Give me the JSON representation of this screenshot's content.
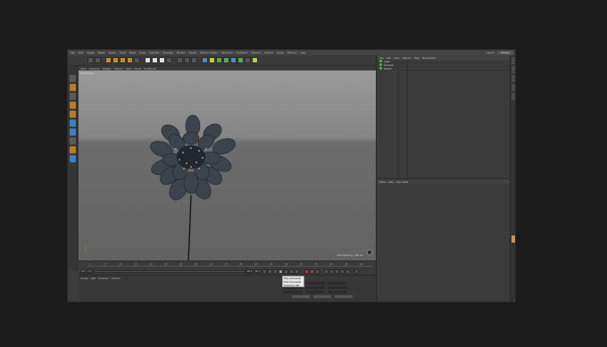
{
  "menubar": {
    "items": [
      "File",
      "Edit",
      "Create",
      "Mode",
      "Select",
      "Tools",
      "Mesh",
      "Snap",
      "Animate",
      "Simulate",
      "Render",
      "Sculpt",
      "Motion Tracker",
      "MoGraph",
      "Character",
      "Pipeline",
      "Plugins",
      "Script",
      "Window",
      "Help"
    ],
    "layout_label": "Layout:",
    "layout_value": "Startup"
  },
  "viewport": {
    "menu": [
      "View",
      "Cameras",
      "Display",
      "Options",
      "Filter",
      "Panel",
      "ProRender"
    ],
    "label": "Perspective",
    "grid_info": "Grid Spacing : 100 cm"
  },
  "timeline": {
    "ticks": [
      "0",
      "5",
      "10",
      "15",
      "20",
      "25",
      "30",
      "35",
      "40",
      "45",
      "50",
      "55",
      "60",
      "65",
      "70",
      "75",
      "80",
      "85",
      "90"
    ],
    "start": "0 F",
    "field_a": "0 F",
    "end_a": "90 F",
    "end_b": "90 F",
    "tooltip_lines": [
      "Play Forwards",
      "Play Forwards",
      "[Shortcut F8]"
    ]
  },
  "material": {
    "tabs": [
      "Create",
      "Edit",
      "Function",
      "Texture"
    ]
  },
  "object_manager": {
    "menu": [
      "File",
      "Edit",
      "View",
      "Objects",
      "Tags",
      "Bookmarks"
    ],
    "rows": [
      "Light",
      "Camera",
      "Flower"
    ]
  },
  "attribute_manager": {
    "menu": [
      "Mode",
      "Edit",
      "User Data"
    ]
  },
  "colors": {
    "accent": "#c88a2a",
    "select": "#4a8ad0"
  }
}
